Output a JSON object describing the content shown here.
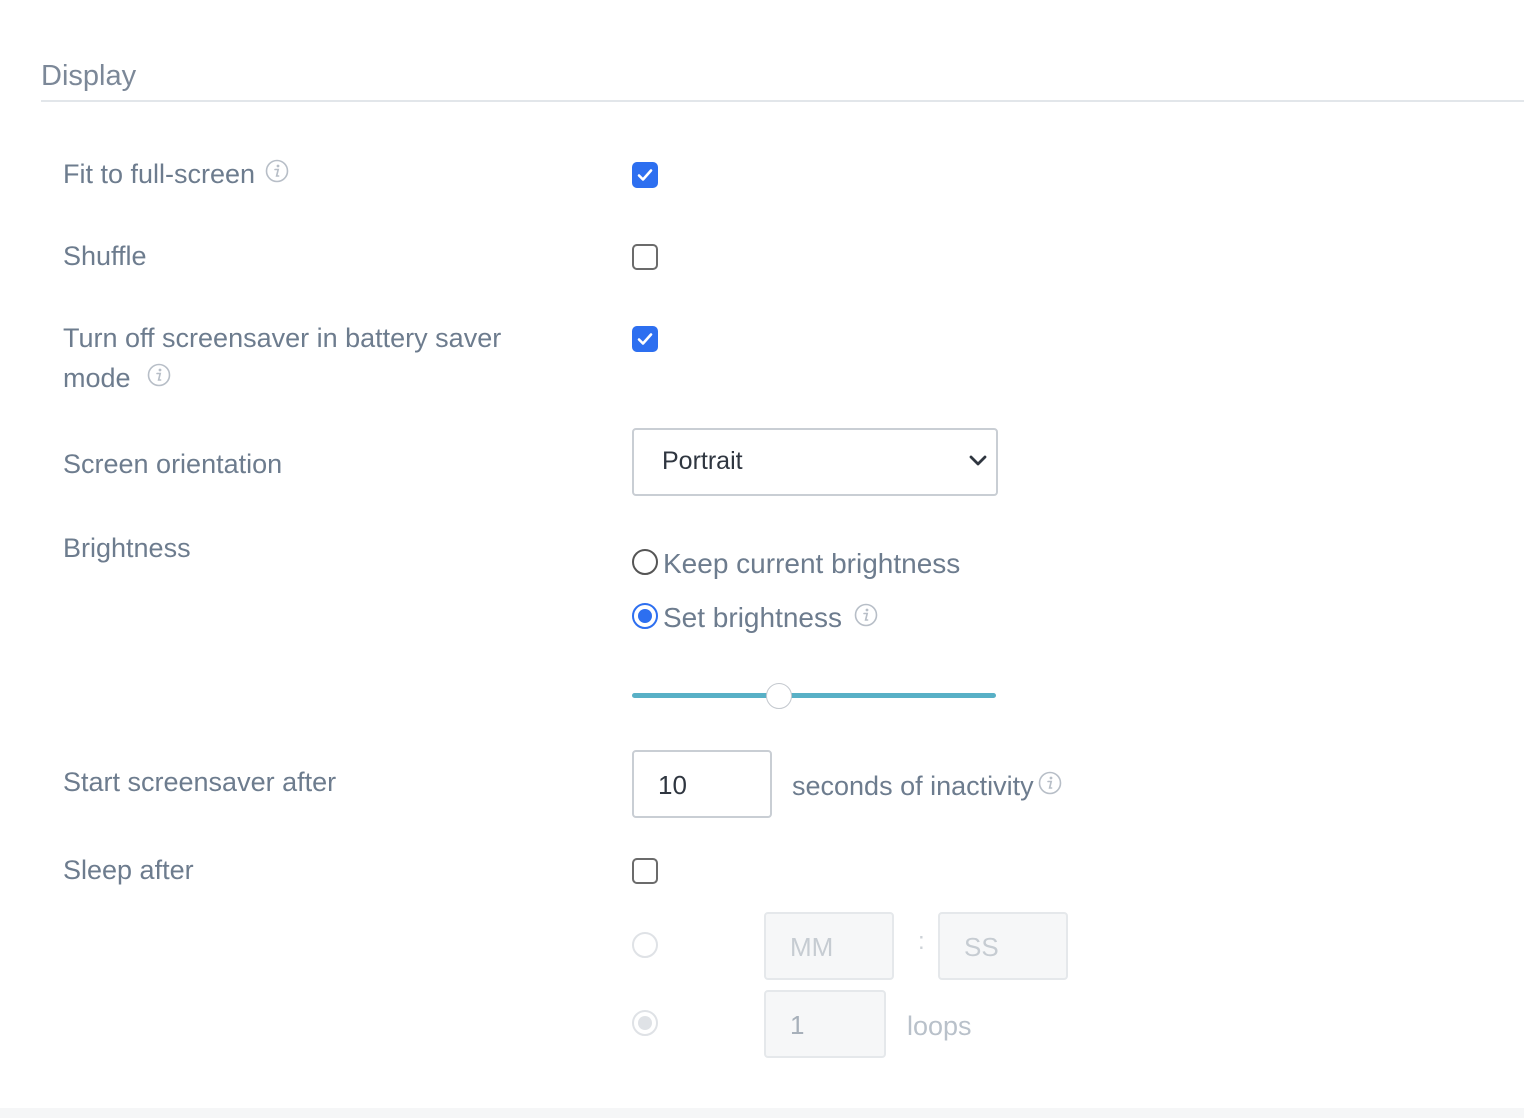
{
  "section": {
    "title": "Display"
  },
  "fit_fullscreen": {
    "label": "Fit to full-screen",
    "checked": true
  },
  "shuffle": {
    "label": "Shuffle",
    "checked": false
  },
  "battery_saver": {
    "label_line1": "Turn off screensaver in battery saver",
    "label_line2": "mode",
    "checked": true
  },
  "orientation": {
    "label": "Screen orientation",
    "selected": "Portrait"
  },
  "brightness": {
    "label": "Brightness",
    "options": [
      "Keep current brightness",
      "Set brightness"
    ],
    "selected_option": "Set brightness",
    "level_fraction": 0.4
  },
  "screensaver_delay": {
    "label": "Start screensaver after",
    "value": "10",
    "suffix": "seconds of inactivity"
  },
  "sleep_after": {
    "label": "Sleep after",
    "checked": false,
    "minutes_placeholder": "MM",
    "separator": ":",
    "seconds_placeholder": "SS",
    "loops_value": "1",
    "loops_suffix": "loops"
  },
  "colors": {
    "accent": "#2d6ff0",
    "slider": "#58b0c6",
    "text": "#6d7c8e"
  },
  "icons": [
    "info-icon",
    "checkmark-icon",
    "chevron-down-icon"
  ]
}
